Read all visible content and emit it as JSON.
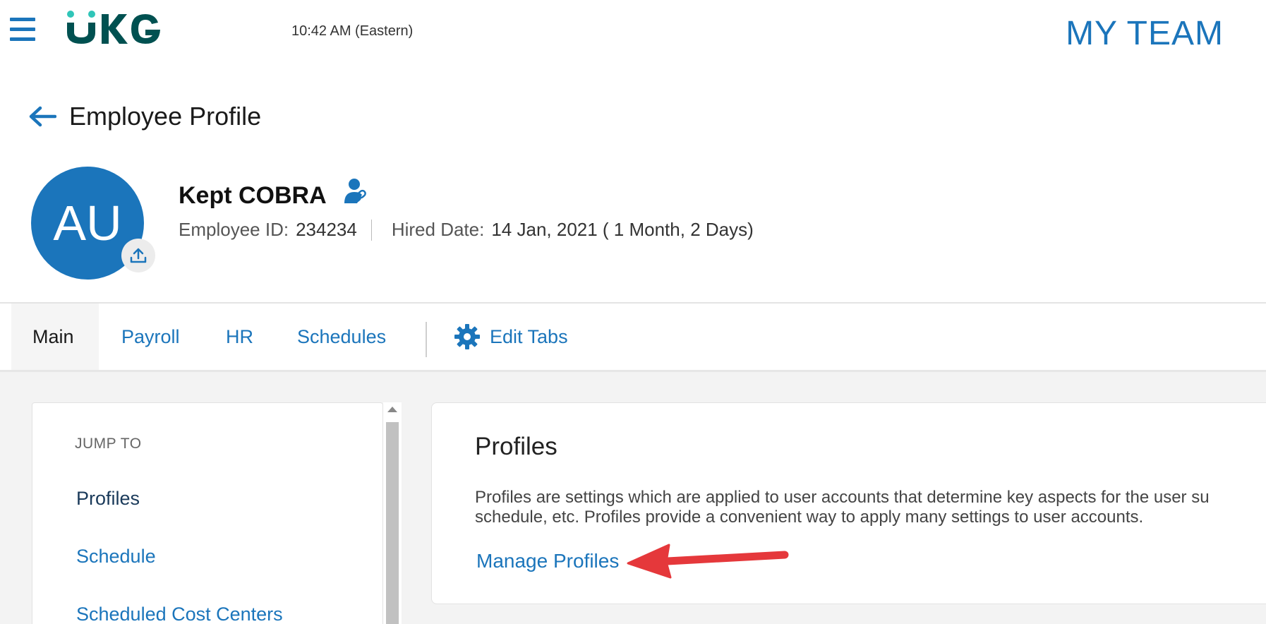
{
  "header": {
    "logo_text": "UKG",
    "time": "10:42 AM (Eastern)",
    "section": "MY TEAM"
  },
  "page": {
    "title": "Employee Profile"
  },
  "employee": {
    "initials": "AU",
    "name": "Kept COBRA",
    "id_label": "Employee ID:",
    "id_value": "234234",
    "hired_label": "Hired Date:",
    "hired_value": "14 Jan, 2021 ( 1 Month, 2 Days)"
  },
  "tabs": [
    {
      "label": "Main",
      "active": true
    },
    {
      "label": "Payroll"
    },
    {
      "label": "HR"
    },
    {
      "label": "Schedules"
    },
    {
      "label": "Edit Tabs"
    }
  ],
  "jump": {
    "label": "JUMP TO",
    "items": [
      "Profiles",
      "Schedule",
      "Scheduled Cost Centers"
    ]
  },
  "profiles_card": {
    "title": "Profiles",
    "description_line1": "Profiles are settings which are applied to user accounts that determine key aspects for the user su",
    "description_line2": "schedule, etc. Profiles provide a convenient way to apply many settings to user accounts.",
    "link": "Manage Profiles"
  },
  "colors": {
    "brand_blue": "#1b75bb",
    "logo_teal": "#005151",
    "logo_accent": "#30c5b8",
    "annotation_red": "#e5383b"
  }
}
